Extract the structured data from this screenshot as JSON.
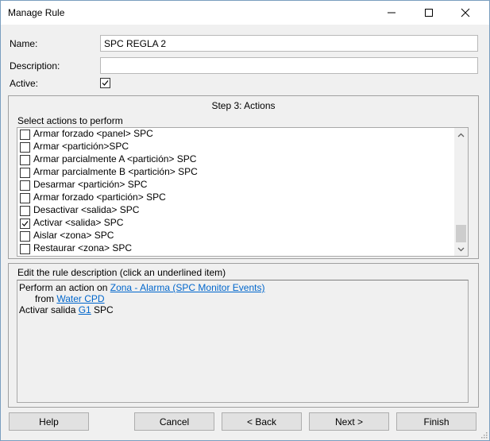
{
  "window": {
    "title": "Manage Rule",
    "controls": {
      "minimize_icon": "minimize-icon",
      "maximize_icon": "maximize-icon",
      "close_icon": "close-icon"
    }
  },
  "form": {
    "name_label": "Name:",
    "name_value": "SPC REGLA 2",
    "description_label": "Description:",
    "description_value": "",
    "active_label": "Active:",
    "active_checked": true
  },
  "actions": {
    "step_title": "Step 3: Actions",
    "select_label": "Select actions to perform",
    "items": [
      {
        "label": "Armar forzado <panel> SPC",
        "checked": false
      },
      {
        "label": "Armar <partición>SPC",
        "checked": false
      },
      {
        "label": "Armar parcialmente A <partición> SPC",
        "checked": false
      },
      {
        "label": "Armar parcialmente B <partición> SPC",
        "checked": false
      },
      {
        "label": "Desarmar <partición> SPC",
        "checked": false
      },
      {
        "label": "Armar forzado <partición> SPC",
        "checked": false
      },
      {
        "label": "Desactivar <salida> SPC",
        "checked": false
      },
      {
        "label": "Activar <salida> SPC",
        "checked": true
      },
      {
        "label": "Aislar <zona> SPC",
        "checked": false
      },
      {
        "label": "Restaurar <zona> SPC",
        "checked": false
      }
    ]
  },
  "rule_description": {
    "label": "Edit the rule description (click an underlined item)",
    "line1_prefix": "Perform an action on ",
    "line1_link": "Zona - Alarma (SPC Monitor Events)",
    "line2_prefix": "from ",
    "line2_link": "Water CPD",
    "line3_prefix": "Activar salida ",
    "line3_link": "G1",
    "line3_suffix": " SPC"
  },
  "buttons": {
    "help": "Help",
    "cancel": "Cancel",
    "back": "< Back",
    "next": "Next >",
    "finish": "Finish"
  }
}
